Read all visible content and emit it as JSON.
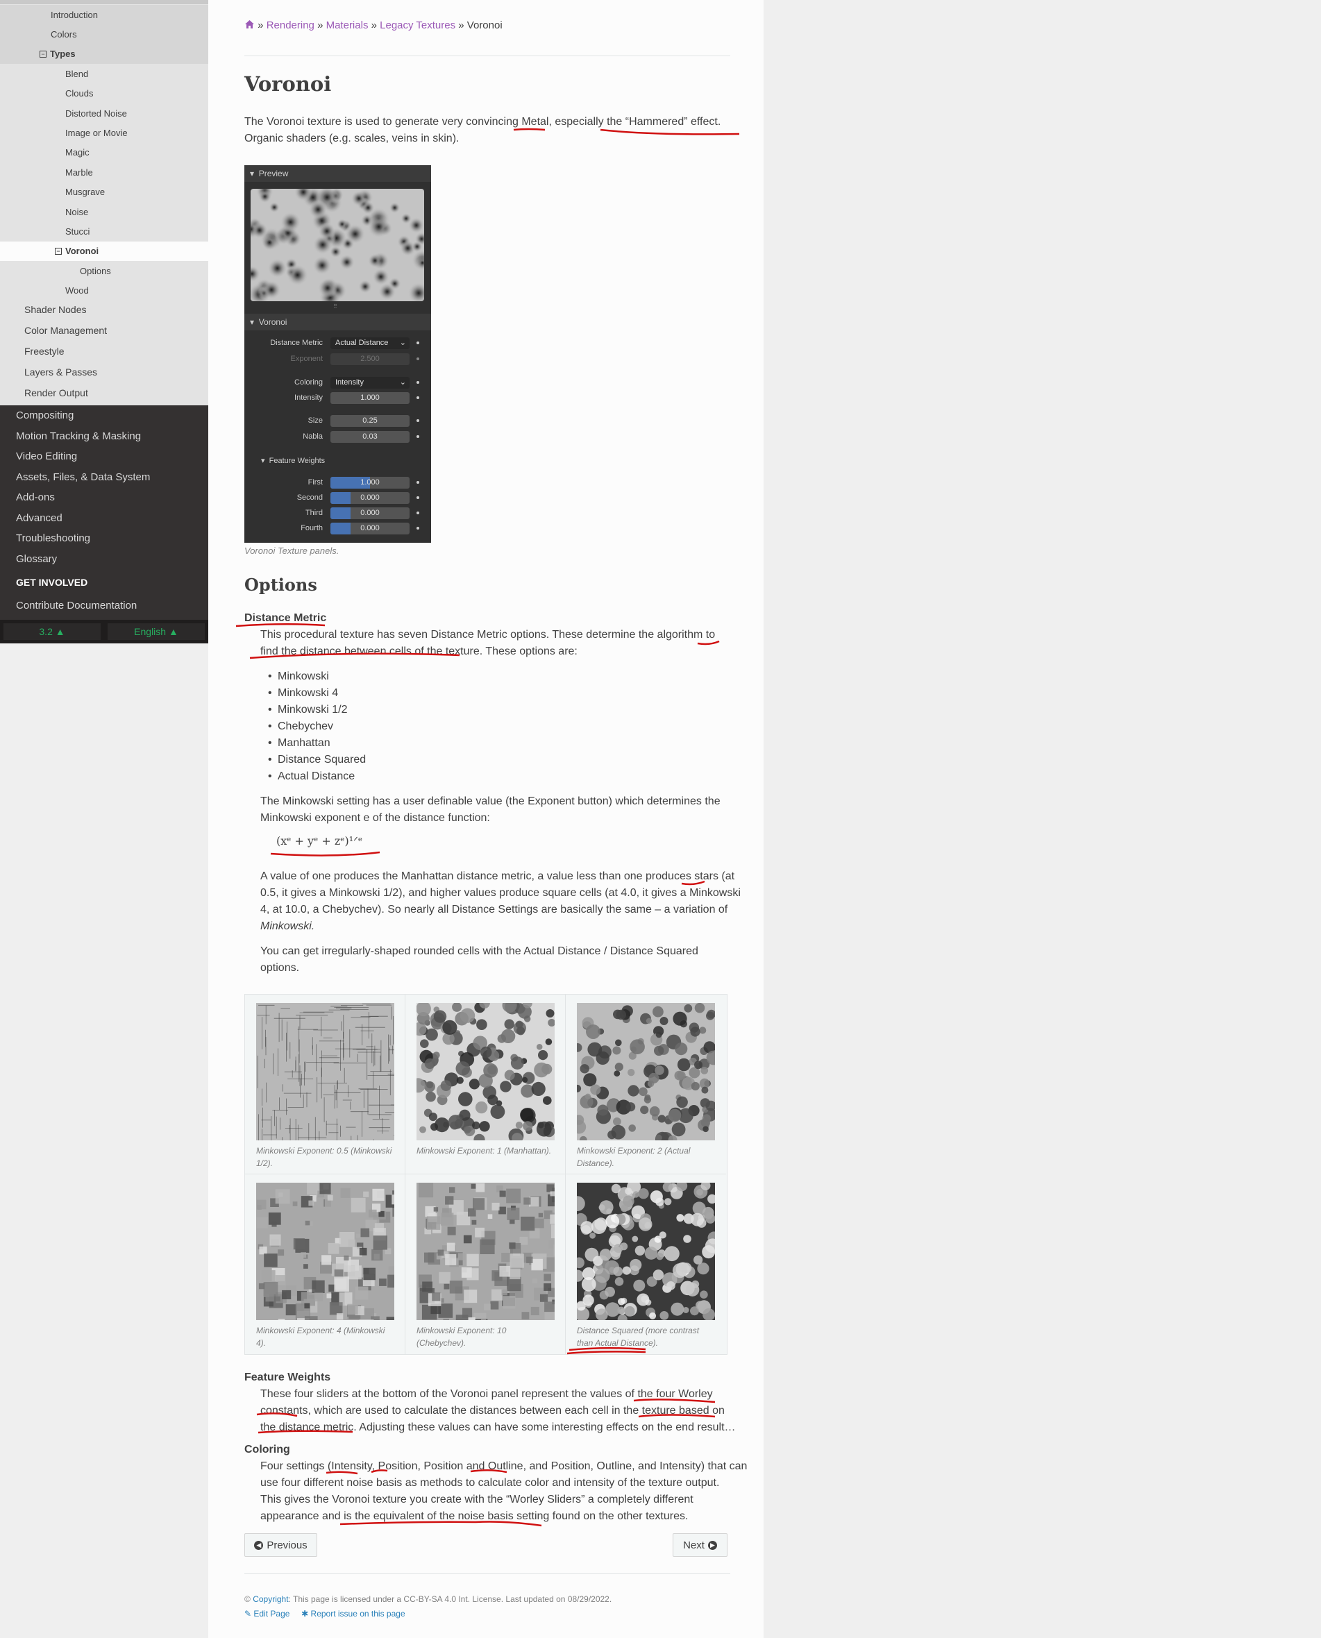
{
  "sidebar": {
    "partial_top": "",
    "light_items": [
      {
        "label": "Introduction",
        "indent": 73,
        "cls": "lvl2",
        "pm": ""
      },
      {
        "label": "Colors",
        "indent": 73,
        "cls": "lvl2",
        "pm": ""
      },
      {
        "label": "Types",
        "indent": 57,
        "cls": "lvl2",
        "pm": "−",
        "bold": true
      },
      {
        "label": "Blend",
        "indent": 94,
        "cls": "lvl3",
        "pm": ""
      },
      {
        "label": "Clouds",
        "indent": 94,
        "cls": "lvl3",
        "pm": ""
      },
      {
        "label": "Distorted Noise",
        "indent": 94,
        "cls": "lvl3",
        "pm": ""
      },
      {
        "label": "Image or Movie",
        "indent": 94,
        "cls": "lvl3",
        "pm": ""
      },
      {
        "label": "Magic",
        "indent": 94,
        "cls": "lvl3",
        "pm": ""
      },
      {
        "label": "Marble",
        "indent": 94,
        "cls": "lvl3",
        "pm": ""
      },
      {
        "label": "Musgrave",
        "indent": 94,
        "cls": "lvl3",
        "pm": ""
      },
      {
        "label": "Noise",
        "indent": 94,
        "cls": "lvl3",
        "pm": ""
      },
      {
        "label": "Stucci",
        "indent": 94,
        "cls": "lvl3",
        "pm": ""
      },
      {
        "label": "Voronoi",
        "indent": 79,
        "cls": "current",
        "pm": "−"
      },
      {
        "label": "Options",
        "indent": 115,
        "cls": "lvl4",
        "pm": ""
      },
      {
        "label": "Wood",
        "indent": 94,
        "cls": "lvl3",
        "pm": ""
      }
    ],
    "mid_items": [
      "Shader Nodes",
      "Color Management",
      "Freestyle",
      "Layers & Passes",
      "Render Output"
    ],
    "dark_items": [
      "Compositing",
      "Motion Tracking & Masking",
      "Video Editing",
      "Assets, Files, & Data System",
      "Add-ons",
      "Advanced",
      "Troubleshooting",
      "Glossary"
    ],
    "section_heading": "GET INVOLVED",
    "contribute": "Contribute Documentation",
    "version": "3.2 ▲",
    "language": "English ▲"
  },
  "breadcrumb": {
    "home_icon": "home-icon",
    "sep": "»",
    "items": [
      "Rendering",
      "Materials",
      "Legacy Textures"
    ],
    "current": "Voronoi"
  },
  "title": "Voronoi",
  "intro": {
    "line1": "The Voronoi texture is used to generate very convincing Metal, especially the “Hammered” effect.",
    "line2": "Organic shaders (e.g. scales, veins in skin)."
  },
  "panel": {
    "preview_header": "Preview",
    "voronoi_header": "Voronoi",
    "distance_metric_label": "Distance Metric",
    "distance_metric_value": "Actual Distance",
    "exponent_label": "Exponent",
    "exponent_value": "2.500",
    "coloring_label": "Coloring",
    "coloring_value": "Intensity",
    "intensity_label": "Intensity",
    "intensity_value": "1.000",
    "size_label": "Size",
    "size_value": "0.25",
    "nabla_label": "Nabla",
    "nabla_value": "0.03",
    "feature_weights_header": "Feature Weights",
    "weights": [
      {
        "label": "First",
        "value": "1.000",
        "fill": 0.5
      },
      {
        "label": "Second",
        "value": "0.000",
        "fill": 0.25
      },
      {
        "label": "Third",
        "value": "0.000",
        "fill": 0.25
      },
      {
        "label": "Fourth",
        "value": "0.000",
        "fill": 0.25
      }
    ],
    "caption": "Voronoi Texture panels."
  },
  "options_heading": "Options",
  "distance_metric": {
    "term": "Distance Metric",
    "line1": "This procedural texture has seven Distance Metric options. These determine the algorithm to",
    "line2": "find the distance between cells of the texture. These options are:",
    "list": [
      "Minkowski",
      "Minkowski 4",
      "Minkowski 1/2",
      "Chebychev",
      "Manhattan",
      "Distance Squared",
      "Actual Distance"
    ],
    "mink1": "The Minkowski setting has a user definable value (the Exponent button) which determines the",
    "mink2": "Minkowski exponent e of the distance function:",
    "formula": "(xᵉ + yᵉ + zᵉ)¹ᐟᵉ",
    "val1": "A value of one produces the Manhattan distance metric, a value less than one produces stars (at",
    "val2": "0.5, it gives a Minkowski 1/2), and higher values produce square cells (at 4.0, it gives a Minkowski",
    "val3": "4, at 10.0, a Chebychev). So nearly all Distance Settings are basically the same – a variation of",
    "val4": "Minkowski.",
    "irr1": "You can get irregularly-shaped rounded cells with the Actual Distance / Distance Squared",
    "irr2": "options."
  },
  "gallery": [
    {
      "cap1": "Minkowski Exponent: 0.5 (Minkowski",
      "cap2": "1/2).",
      "style": "a"
    },
    {
      "cap1": "Minkowski Exponent: 1 (Manhattan).",
      "cap2": "",
      "style": "b"
    },
    {
      "cap1": "Minkowski Exponent: 2 (Actual",
      "cap2": "Distance).",
      "style": "c"
    },
    {
      "cap1": "Minkowski Exponent: 4 (Minkowski",
      "cap2": "4).",
      "style": "d"
    },
    {
      "cap1": "Minkowski Exponent: 10",
      "cap2": "(Chebychev).",
      "style": "d"
    },
    {
      "cap1": "Distance Squared (more contrast",
      "cap2": "than Actual Distance).",
      "style": "e"
    }
  ],
  "feature_weights": {
    "term": "Feature Weights",
    "l1": "These four sliders at the bottom of the Voronoi panel represent the values of the four Worley",
    "l2": "constants, which are used to calculate the distances between each cell in the texture based on",
    "l3": "the distance metric. Adjusting these values can have some interesting effects on the end result…"
  },
  "coloring": {
    "term": "Coloring",
    "l1": "Four settings (Intensity, Position, Position and Outline, and Position, Outline, and Intensity) that can",
    "l2": "use four different noise basis as methods to calculate color and intensity of the texture output.",
    "l3": "This gives the Voronoi texture you create with the “Worley Sliders” a completely different",
    "l4": "appearance and is the equivalent of the noise basis setting found on the other textures."
  },
  "nav": {
    "previous": "Previous",
    "next": "Next"
  },
  "footer": {
    "copyright_link": "Copyright",
    "license": ": This page is licensed under a CC-BY-SA 4.0 Int. License. Last updated on 08/29/2022.",
    "edit": "Edit Page",
    "report": "Report issue on this page"
  }
}
